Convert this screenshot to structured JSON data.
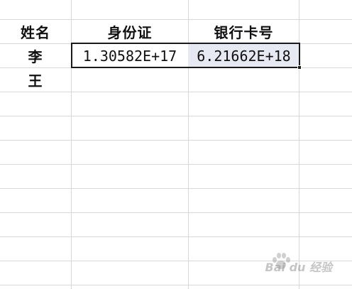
{
  "sheet": {
    "headers": {
      "name": "姓名",
      "id_card": "身份证",
      "bank_card": "银行卡号"
    },
    "rows": [
      {
        "name": "李",
        "id_card": "1.30582E+17",
        "bank_card": "6.21662E+18"
      },
      {
        "name": "王",
        "id_card": "",
        "bank_card": ""
      }
    ]
  },
  "watermark": "Bai du 经验",
  "colors": {
    "gridline": "#d8d8d8",
    "selection_border": "#1a1a1a",
    "selected_fill": "#e6e9f2"
  }
}
